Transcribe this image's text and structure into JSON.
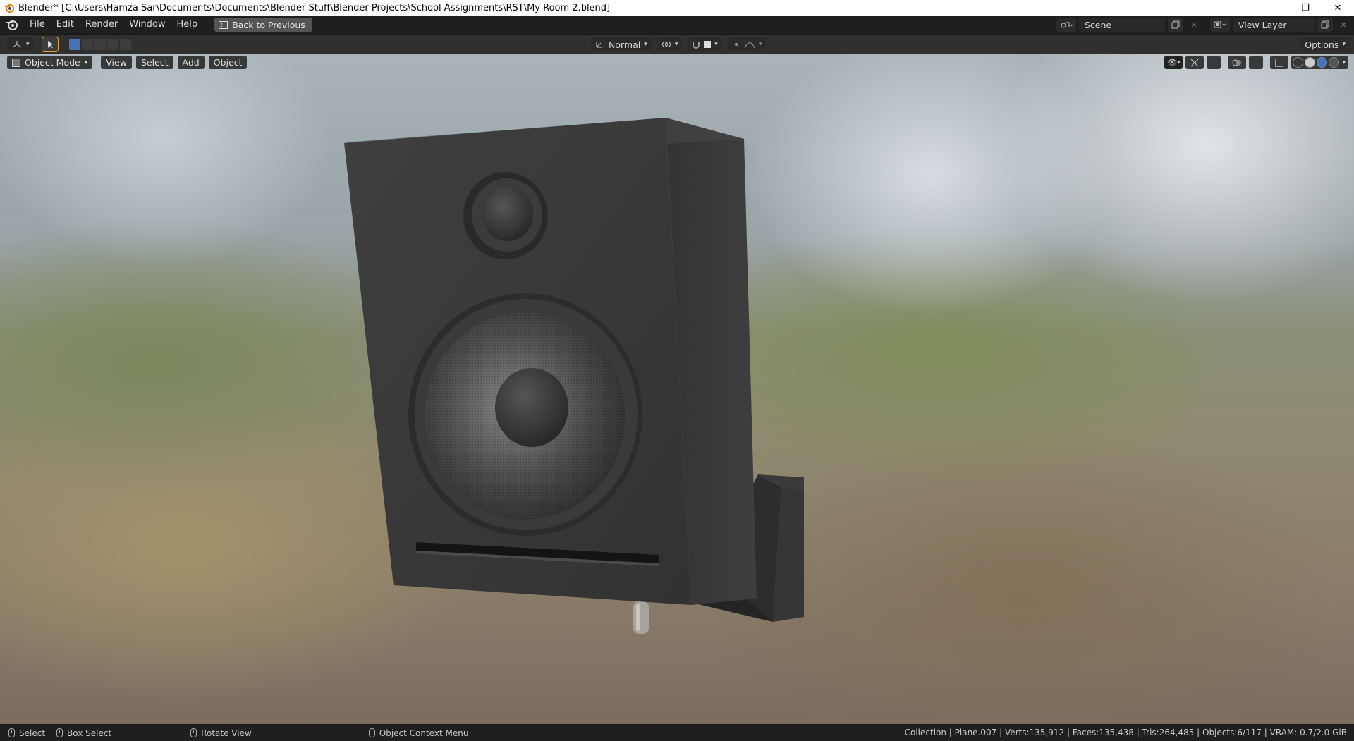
{
  "window": {
    "title": "Blender* [C:\\Users\\Hamza Sar\\Documents\\Documents\\Blender Stuff\\Blender Projects\\School Assignments\\RST\\My Room 2.blend]",
    "minimize_glyph": "—",
    "restore_glyph": "❐",
    "close_glyph": "✕"
  },
  "topbar": {
    "menus": [
      "File",
      "Edit",
      "Render",
      "Window",
      "Help"
    ],
    "back_label": "Back to Previous",
    "scene_value": "Scene",
    "view_layer_value": "View Layer"
  },
  "tool_header": {
    "transform_orientation": "Normal",
    "options_label": "Options"
  },
  "viewport_header": {
    "mode_label": "Object Mode",
    "menus": [
      "View",
      "Select",
      "Add",
      "Object"
    ],
    "shading": {
      "modes": [
        "wireframe",
        "solid",
        "material-preview",
        "rendered"
      ],
      "active": "material-preview"
    }
  },
  "statusbar": {
    "hints": [
      {
        "label": "Select",
        "icon": "mouse-left-icon"
      },
      {
        "label": "Box Select",
        "icon": "mouse-drag-icon"
      },
      {
        "label": "Rotate View",
        "icon": "mouse-middle-icon"
      },
      {
        "label": "Object Context Menu",
        "icon": "mouse-right-icon"
      }
    ],
    "stats": "Collection | Plane.007 | Verts:135,912 | Faces:135,438 | Tris:264,485 | Objects:6/117 | VRAM: 0.7/2.0 GiB"
  },
  "colors": {
    "accent": "#4772b3",
    "header_bg": "#303030",
    "topbar_bg": "#1f1f1f",
    "speaker_body": "#3a3a3a"
  }
}
